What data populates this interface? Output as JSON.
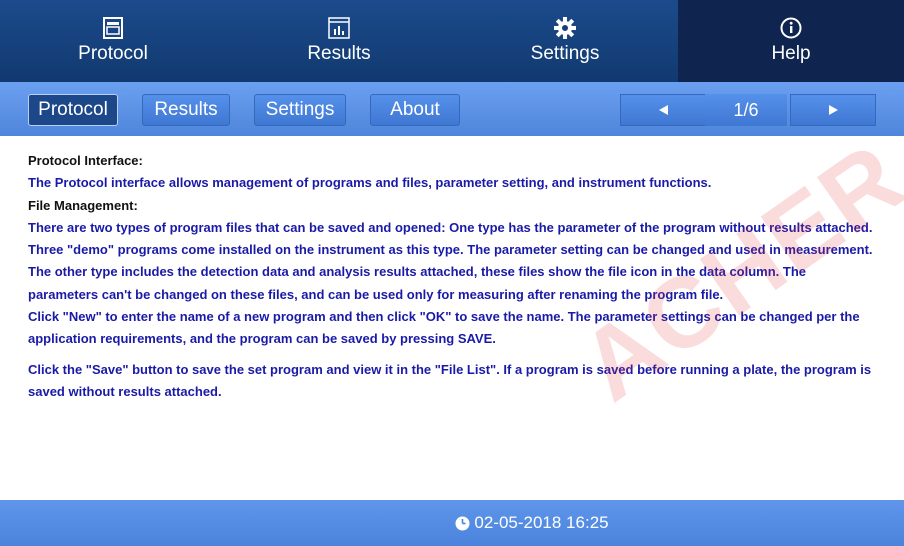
{
  "top_tabs": {
    "protocol": "Protocol",
    "results": "Results",
    "settings": "Settings",
    "help": "Help",
    "active": "help"
  },
  "sub_tabs": {
    "protocol": "Protocol",
    "results": "Results",
    "settings": "Settings",
    "about": "About",
    "active": "protocol"
  },
  "pager": {
    "text": "1/6",
    "prev_icon": "triangle-left-icon",
    "next_icon": "triangle-right-icon"
  },
  "content": {
    "heading1": "Protocol Interface:",
    "para1": "The Protocol interface allows management of programs and files, parameter setting, and instrument functions.",
    "heading2": "File Management:",
    "para2": "There are two types of program files that can be saved and opened: One type has the parameter of the program without results attached.  Three \"demo\" programs come installed on the instrument as this type.  The parameter setting can be changed and used in measurement.  The other type includes the detection data and analysis results attached, these files show the file icon in the data column.  The parameters can't be changed on these files, and can be used only for measuring after renaming the program file.",
    "para3": "Click \"New\" to enter the name of a new program and then click \"OK\" to save the name.  The parameter settings can be changed per the application requirements, and the program can be saved by pressing SAVE.",
    "para4": "Click the \"Save\" button to save the set program and view it in the \"File List\".  If a program is saved before running a plate, the program is saved without results attached."
  },
  "footer": {
    "datetime": "02-05-2018 16:25",
    "clock_icon": "clock-icon"
  },
  "watermark": "ACHER",
  "colors": {
    "topnav": "#12396f",
    "active_tab": "#0f2550",
    "subnav": "#5a90e4",
    "text_blue": "#1a1aa8",
    "text_black": "#111111"
  }
}
